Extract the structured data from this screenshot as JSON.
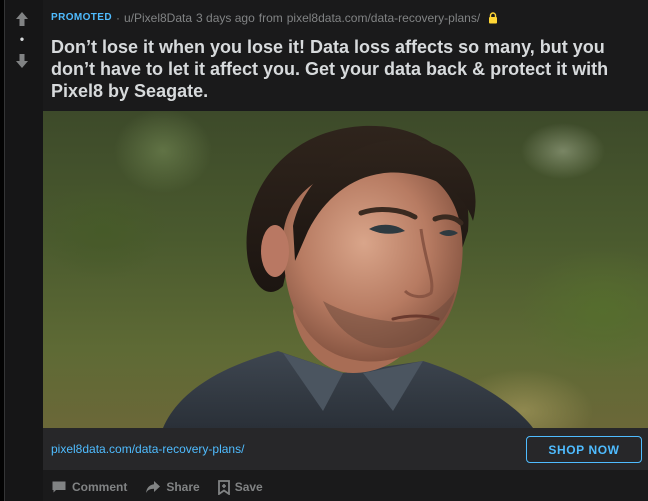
{
  "post": {
    "promoted_label": "PROMOTED",
    "separator": "·",
    "author": "u/Pixel8Data",
    "time": "3 days ago",
    "from_label": "from",
    "domain": "pixel8data.com/data-recovery-plans/",
    "title": "Don’t lose it when you lose it! Data loss affects so many, but you don’t have to let it affect you. Get your data back & protect it with Pixel8 by Seagate.",
    "vote_score": "•"
  },
  "link_bar": {
    "url": "pixel8data.com/data-recovery-plans/",
    "cta_label": "SHOP NOW"
  },
  "actions": {
    "comment": "Comment",
    "share": "Share",
    "save": "Save"
  },
  "colors": {
    "accent": "#4fbcff",
    "lock": "#ffd635",
    "muted": "#818384",
    "text": "#d7dadc",
    "card": "#1a1a1b"
  },
  "icons": [
    "upvote-icon",
    "downvote-icon",
    "lock-icon",
    "comment-icon",
    "share-icon",
    "save-icon"
  ]
}
